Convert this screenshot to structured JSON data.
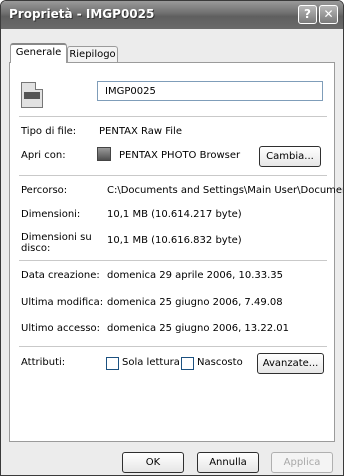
{
  "window": {
    "title": "Proprietà - IMGP0025"
  },
  "titlebar_buttons": {
    "help": "?",
    "close": "✕"
  },
  "tabs": [
    {
      "label": "Generale"
    },
    {
      "label": "Riepilogo"
    }
  ],
  "file": {
    "name": "IMGP0025"
  },
  "properties": {
    "type": {
      "label": "Tipo di file:",
      "value": "PENTAX Raw File"
    },
    "open_with": {
      "label": "Apri con:",
      "value": "PENTAX PHOTO Browser",
      "button": "Cambia..."
    },
    "path": {
      "label": "Percorso:",
      "value": "C:\\Documents and Settings\\Main User\\Documer"
    },
    "size": {
      "label": "Dimensioni:",
      "value": "10,1 MB (10.614.217 byte)"
    },
    "disk_size": {
      "label_line1": "Dimensioni su",
      "label_line2": "disco:",
      "value": "10,1 MB (10.616.832 byte)"
    },
    "created": {
      "label": "Data creazione:",
      "value": "domenica 29 aprile 2006, 10.33.35"
    },
    "modified": {
      "label": "Ultima modifica:",
      "value": "domenica 25 giugno 2006, 7.49.08"
    },
    "accessed": {
      "label": "Ultimo accesso:",
      "value": "domenica 25 giugno 2006, 13.22.01"
    }
  },
  "attributes": {
    "label": "Attributi:",
    "readonly": {
      "label": "Sola lettura",
      "checked": false
    },
    "hidden": {
      "label": "Nascosto",
      "checked": false
    },
    "advanced_button": "Avanzate..."
  },
  "footer": {
    "ok": "OK",
    "cancel": "Annulla",
    "apply": "Applica"
  }
}
